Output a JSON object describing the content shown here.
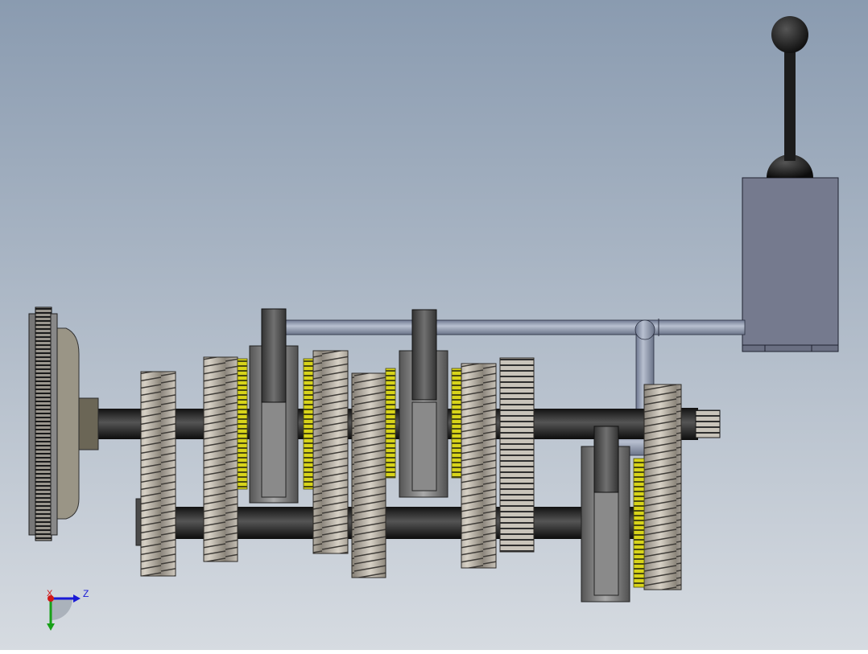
{
  "viewport": {
    "background_top": "#8a9bb0",
    "background_bottom": "#d6dbe1"
  },
  "colors": {
    "gear_metal": "#b7b1a7",
    "gear_dark": "#3a3a3a",
    "synchro_yellow": "#d8d41a",
    "shaft": "#262626",
    "fork": "#4a4a4a",
    "rod": "#8f99ad",
    "shifter_box": "#757a8e",
    "axis_x": "#d11818",
    "axis_y": "#18a018",
    "axis_z": "#1a1ad6"
  },
  "triad": {
    "x_label": "X",
    "z_label": "Z",
    "icons": [
      "x-axis-arrow-icon",
      "y-axis-arrow-icon",
      "z-axis-arrow-icon"
    ]
  }
}
